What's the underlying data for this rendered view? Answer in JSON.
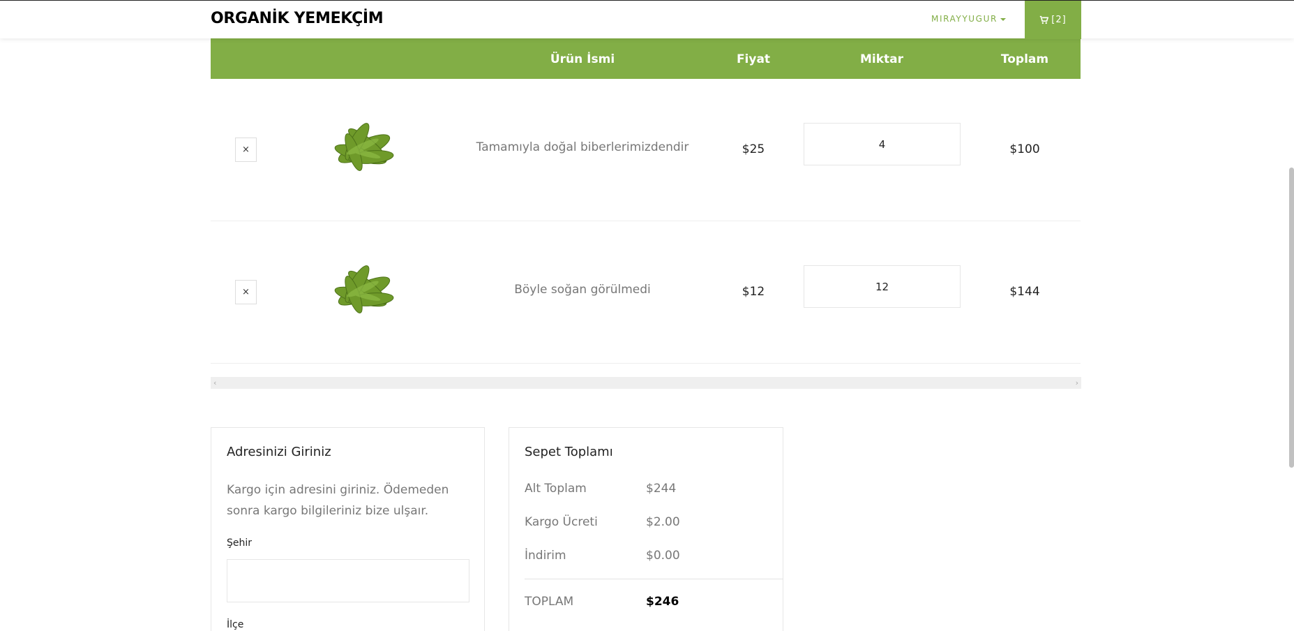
{
  "nav": {
    "brand": "ORGANİK YEMEKÇİM",
    "user_label": "MIRAYYUGUR",
    "cart_label": "[2]",
    "accent_color": "#82ae46"
  },
  "table": {
    "headers": [
      "Ürün İsmi",
      "Fiyat",
      "Miktar",
      "Toplam"
    ],
    "rows": [
      {
        "remove": "×",
        "name": "Tamamıyla doğal biberlerimizdendir",
        "price": "$25",
        "quantity": "4",
        "total": "$100"
      },
      {
        "remove": "×",
        "name": "Böyle soğan görülmedi",
        "price": "$12",
        "quantity": "12",
        "total": "$144"
      }
    ]
  },
  "scrollbar": {
    "left_arrow": "‹",
    "right_arrow": "›"
  },
  "address": {
    "title": "Adresinizi Giriniz",
    "description": "Kargo için adresini giriniz. Ödemeden sonra kargo bilgileriniz bize ulşaır.",
    "city_label": "Şehir",
    "city_value": "",
    "district_label": "İlçe"
  },
  "summary": {
    "title": "Sepet Toplamı",
    "subtotal_label": "Alt Toplam",
    "subtotal_value": "$244",
    "shipping_label": "Kargo Ücreti",
    "shipping_value": "$2.00",
    "discount_label": "İndirim",
    "discount_value": "$0.00",
    "total_label": "TOPLAM",
    "total_value": "$246"
  }
}
